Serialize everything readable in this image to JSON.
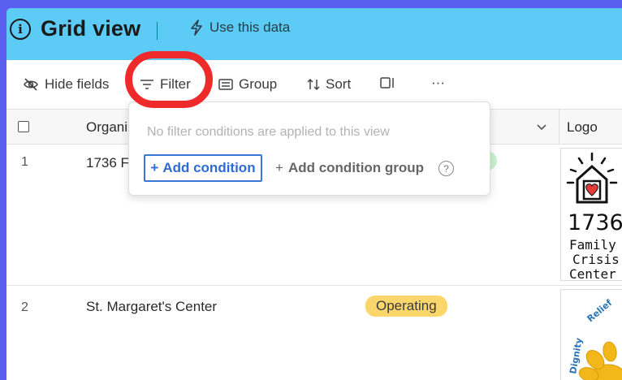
{
  "header": {
    "title": "Grid view",
    "use_data_label": "Use this data"
  },
  "toolbar": {
    "hide_fields": "Hide fields",
    "filter": "Filter",
    "group": "Group",
    "sort": "Sort",
    "more": "···"
  },
  "grid": {
    "columns": [
      "Organi",
      "Logo"
    ],
    "rows": [
      {
        "num": "1",
        "org": "1736 Fa",
        "status": "",
        "logo_text": [
          "1736",
          "Family",
          "Crisis",
          "Center"
        ]
      },
      {
        "num": "2",
        "org": "St. Margaret's Center",
        "status": "Operating",
        "logo_text": [
          "Relief",
          "Dignity"
        ]
      }
    ]
  },
  "filter_popup": {
    "message": "No filter conditions are applied to this view",
    "add_condition": "Add condition",
    "add_condition_group": "Add condition group"
  },
  "colors": {
    "header_bg": "#5ccbf5",
    "accent_blue": "#2f6bd1",
    "highlight_red": "#ef2a2a",
    "status_yellow": "#fbd66a",
    "status_green": "#c9f1cf"
  }
}
